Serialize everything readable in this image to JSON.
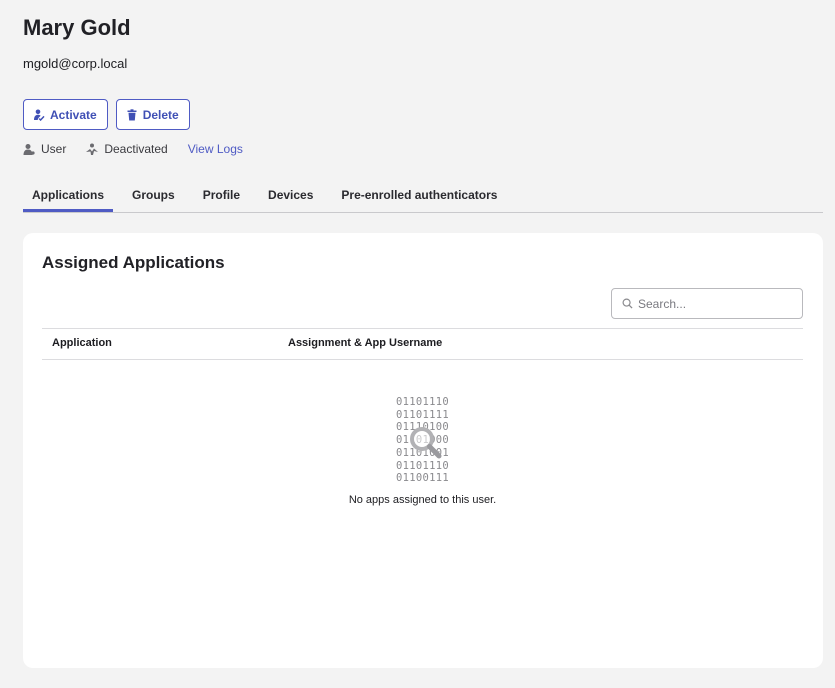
{
  "user": {
    "name": "Mary Gold",
    "email": "mgold@corp.local"
  },
  "actions": {
    "activate_label": "Activate",
    "delete_label": "Delete"
  },
  "meta": {
    "role": "User",
    "status": "Deactivated",
    "view_logs": "View Logs"
  },
  "tabs": [
    {
      "label": "Applications",
      "active": true
    },
    {
      "label": "Groups",
      "active": false
    },
    {
      "label": "Profile",
      "active": false
    },
    {
      "label": "Devices",
      "active": false
    },
    {
      "label": "Pre-enrolled authenticators",
      "active": false
    }
  ],
  "card": {
    "title": "Assigned Applications",
    "search_placeholder": "Search...",
    "columns": [
      "Application",
      "Assignment & App Username"
    ],
    "empty": {
      "binary_lines": [
        "01101110",
        "01101111",
        "01110100",
        "01101000",
        "01101001",
        "01101110",
        "01100111"
      ],
      "message": "No apps assigned to this user."
    }
  },
  "colors": {
    "accent": "#4f5bc4",
    "background": "#f3f3f3",
    "card": "#ffffff"
  },
  "icons": {
    "activate": "person-check-icon",
    "delete": "trash-icon",
    "role": "user-icon",
    "status": "deactivated-icon",
    "search": "search-icon",
    "empty": "magnifier-icon"
  }
}
